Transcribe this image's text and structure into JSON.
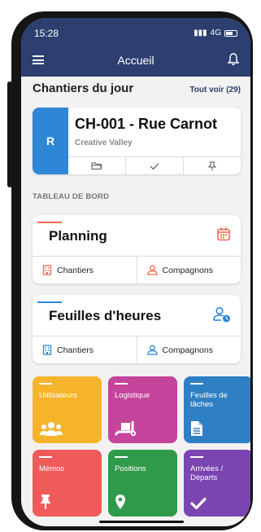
{
  "status": {
    "time": "15:28",
    "network": "4G"
  },
  "header": {
    "title": "Accueil"
  },
  "today": {
    "title": "Chantiers du jour",
    "see_all": "Tout voir (29)"
  },
  "chantier": {
    "badge": "R",
    "name": "CH-001 - Rue Carnot",
    "client": "Creative Valley"
  },
  "board": {
    "label": "TABLEAU DE BORD",
    "planning": {
      "title": "Planning",
      "links": [
        "Chantiers",
        "Compagnons"
      ]
    },
    "timesheets": {
      "title": "Feuilles d'heures",
      "links": [
        "Chantiers",
        "Compagnons"
      ]
    }
  },
  "tiles": [
    {
      "label": "Utilisateurs",
      "color": "#f6b42c",
      "icon": "users-icon"
    },
    {
      "label": "Logistique",
      "color": "#c5449c",
      "icon": "truck-icon"
    },
    {
      "label": "Feuilles de tâches",
      "color": "#2f7fc4",
      "icon": "document-icon"
    },
    {
      "label": "Mémos",
      "color": "#ef5a5a",
      "icon": "pin-icon"
    },
    {
      "label": "Positions",
      "color": "#2f9a4a",
      "icon": "location-icon"
    },
    {
      "label": "Arrivées / Départs",
      "color": "#7a45b0",
      "icon": "check-icon"
    }
  ],
  "colors": {
    "header": "#2c3f70",
    "accent": "#ef6a4e",
    "blue": "#2f86d6"
  }
}
